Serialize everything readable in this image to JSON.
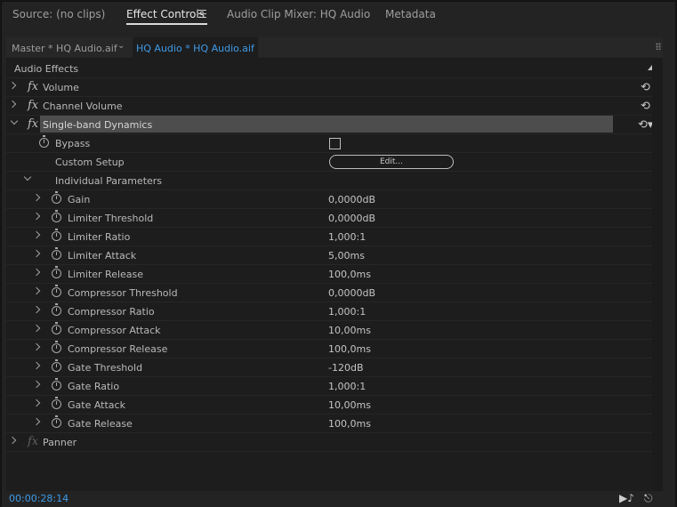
{
  "tabs": [
    {
      "label": "Source: (no clips)",
      "active": false
    },
    {
      "label": "Effect Controls",
      "active": true
    },
    {
      "label": "Audio Clip Mixer: HQ Audio",
      "active": false
    },
    {
      "label": "Metadata",
      "active": false
    }
  ],
  "clipbar": {
    "master": "Master * HQ Audio.aif",
    "active": "HQ Audio * HQ Audio.aif"
  },
  "section": "Audio Effects",
  "effects": {
    "volume": "Volume",
    "channel_volume": "Channel Volume",
    "dynamics": "Single-band Dynamics",
    "panner": "Panner"
  },
  "dynamics": {
    "bypass": "Bypass",
    "custom_setup": "Custom Setup",
    "edit_button": "Edit...",
    "individual_parameters": "Individual Parameters"
  },
  "params": [
    {
      "name": "Gain",
      "value": "0,0000dB"
    },
    {
      "name": "Limiter Threshold",
      "value": "0,0000dB"
    },
    {
      "name": "Limiter Ratio",
      "value": "1,000:1"
    },
    {
      "name": "Limiter Attack",
      "value": "5,00ms"
    },
    {
      "name": "Limiter Release",
      "value": "100,0ms"
    },
    {
      "name": "Compressor Threshold",
      "value": "0,0000dB"
    },
    {
      "name": "Compressor Ratio",
      "value": "1,000:1"
    },
    {
      "name": "Compressor Attack",
      "value": "10,00ms"
    },
    {
      "name": "Compressor Release",
      "value": "100,0ms"
    },
    {
      "name": "Gate Threshold",
      "value": "-120dB"
    },
    {
      "name": "Gate Ratio",
      "value": "1,000:1"
    },
    {
      "name": "Gate Attack",
      "value": "10,00ms"
    },
    {
      "name": "Gate Release",
      "value": "100,0ms"
    }
  ],
  "timecode": "00:00:28:14",
  "colors": {
    "accent": "#3f9be8",
    "selection": "#4d4d4d"
  }
}
